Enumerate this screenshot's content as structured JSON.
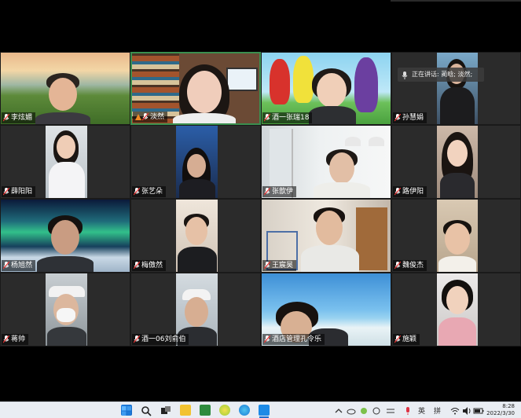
{
  "participants": [
    {
      "name": "李炫媚",
      "muted": true
    },
    {
      "name": "淡然",
      "muted": false
    },
    {
      "name": "酒一张瑞18",
      "muted": true
    },
    {
      "name": "孙慧娟",
      "muted": true
    },
    {
      "name": "薛阳阳",
      "muted": true
    },
    {
      "name": "张艺朵",
      "muted": true
    },
    {
      "name": "张歆伊",
      "muted": true
    },
    {
      "name": "路伊阳",
      "muted": true
    },
    {
      "name": "杨旭然",
      "muted": true
    },
    {
      "name": "梅傲然",
      "muted": true
    },
    {
      "name": "王宸昊",
      "muted": true
    },
    {
      "name": "魏俊杰",
      "muted": true
    },
    {
      "name": "蒋帅",
      "muted": true
    },
    {
      "name": "酒一06刘俞伯",
      "muted": true
    },
    {
      "name": "酒店管理孔令乐",
      "muted": true
    },
    {
      "name": "施颖",
      "muted": true
    }
  ],
  "speaking_indicator": {
    "label": "正在讲话: 蔺晗; 淡然;"
  },
  "taskbar": {
    "ime_lang": "英",
    "ime_mode": "拼",
    "time": "8:28",
    "date": "2022/3/30"
  },
  "colors": {
    "speaking_border": "#3a8f4f",
    "nameplate_bg": "#000000",
    "taskbar_bg": "#e9edf3"
  }
}
